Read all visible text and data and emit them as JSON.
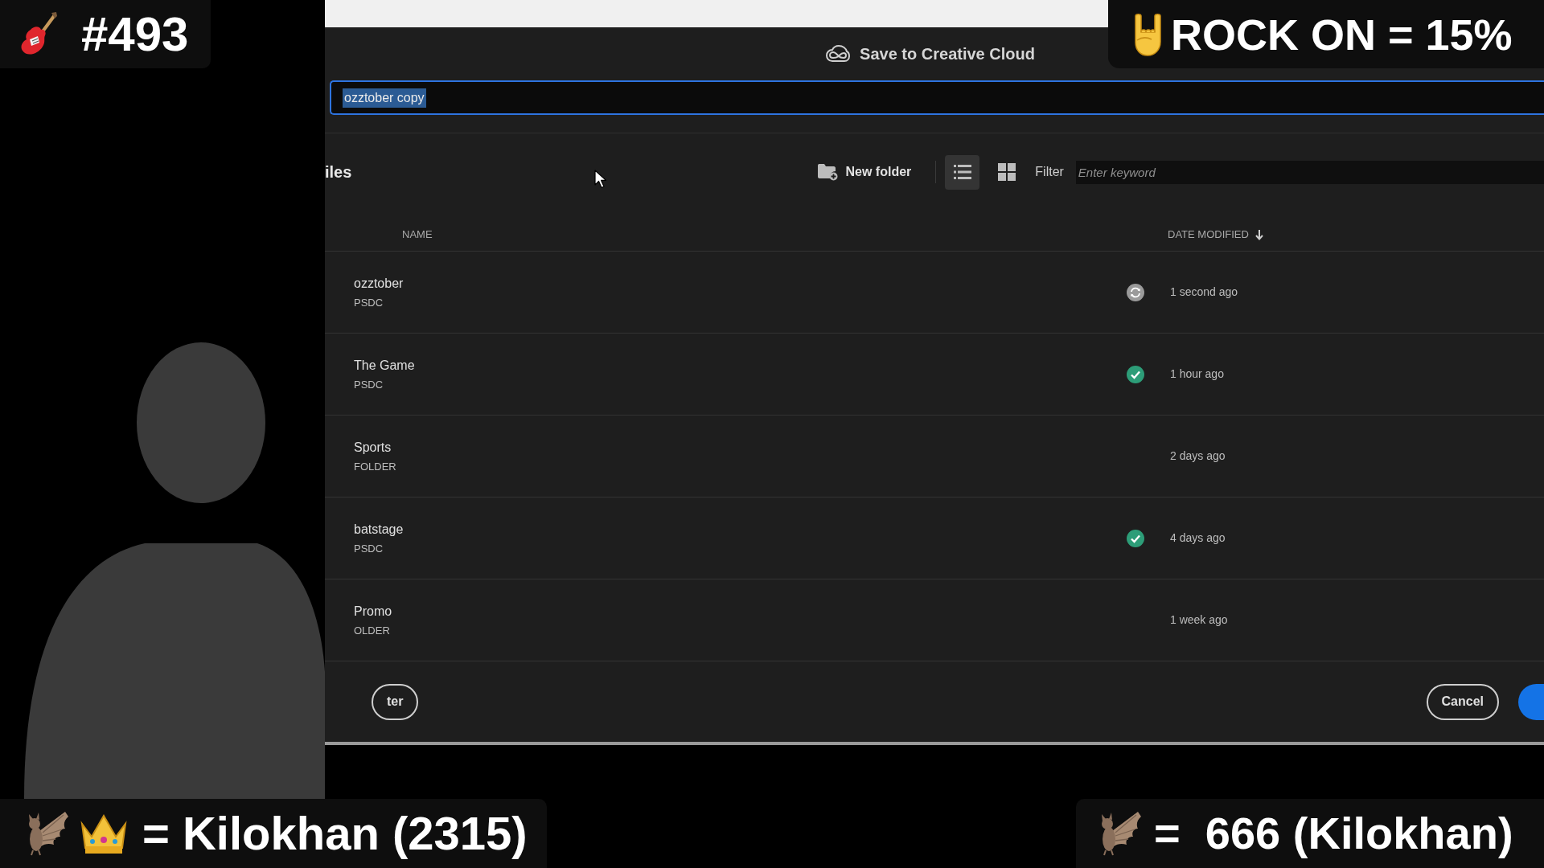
{
  "overlays": {
    "episode": "#493",
    "rock_on": "ROCK ON = 15%",
    "crown_holder": "= Kilokhan (2315)",
    "bat_holder": "=  666 (Kilokhan)"
  },
  "dialog": {
    "title": "Save to Creative Cloud",
    "filename": {
      "value": "ozztober copy",
      "text_selected": true
    },
    "toolbar": {
      "heading": "iles",
      "new_folder": "New folder",
      "views": [
        {
          "kind": "list",
          "selected": true
        },
        {
          "kind": "grid",
          "selected": false
        }
      ],
      "filter": {
        "label": "Filter",
        "placeholder": "Enter keyword"
      }
    },
    "columns": [
      {
        "label": "NAME",
        "sorted": false
      },
      {
        "label": "DATE MODIFIED",
        "sorted": true
      }
    ],
    "files": [
      {
        "name": "ozztober",
        "type": "PSDC",
        "syncing": true,
        "synced": false,
        "modified": "1 second ago"
      },
      {
        "name": "The Game",
        "type": "PSDC",
        "syncing": false,
        "synced": true,
        "modified": "1 hour ago"
      },
      {
        "name": "Sports",
        "type": "FOLDER",
        "syncing": false,
        "synced": false,
        "modified": "2 days ago"
      },
      {
        "name": "batstage",
        "type": "PSDC",
        "syncing": false,
        "synced": true,
        "modified": "4 days ago"
      },
      {
        "name": "Promo",
        "type": "OLDER",
        "syncing": false,
        "synced": false,
        "modified": "1 week ago"
      }
    ],
    "buttons": [
      {
        "label": "ter",
        "kind": "secondary"
      },
      {
        "label": "Cancel",
        "kind": "secondary"
      },
      {
        "kind": "primary"
      }
    ]
  }
}
